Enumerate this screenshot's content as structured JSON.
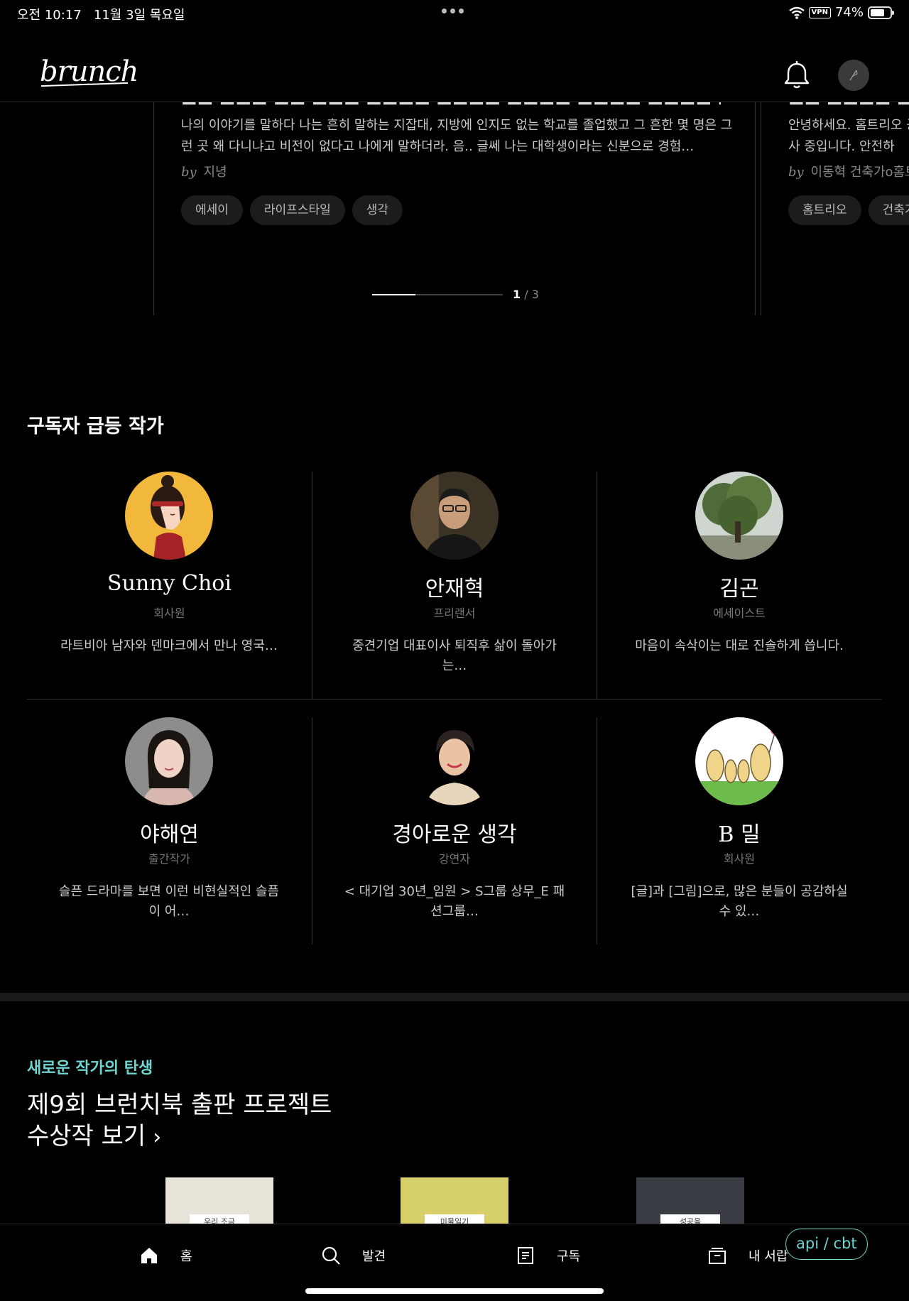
{
  "status_bar": {
    "time": "오전 10:17",
    "date": "11월 3일 목요일",
    "vpn": "VPN",
    "battery": "74%",
    "battery_level": 0.74
  },
  "header": {
    "logo": "brunch",
    "icons": [
      "bell-icon",
      "pen-icon"
    ]
  },
  "carousel": {
    "main_card": {
      "excerpt": "나의 이야기를 말하다 나는 흔히 말하는 지잡대, 지방에 인지도 없는 학교를 졸업했고 그 흔한 몇 명은 그런 곳 왜 다니냐고 비전이 없다고 나에게 말하더라. 음.. 글쎄 나는 대학생이라는 신분으로 경험…",
      "by": "by",
      "author": "지녕",
      "tags": [
        "에세이",
        "라이프스타일",
        "생각"
      ]
    },
    "next_card": {
      "excerpt": "안녕하세요. 홈트리오 공사 중입니다. 안전하",
      "by": "by",
      "author": "이동혁 건축가o홈트",
      "tags": [
        "홈트리오",
        "건축가"
      ]
    },
    "pager": {
      "current": "1",
      "separator": "/",
      "total": "3",
      "progress": 0.333
    }
  },
  "rising_authors": {
    "title": "구독자 급등 작가",
    "authors": [
      {
        "name": "Sunny Choi",
        "job": "회사원",
        "desc": "라트비아 남자와 덴마크에서 만나 영국…"
      },
      {
        "name": "안재혁",
        "job": "프리랜서",
        "desc": "중견기업 대표이사 퇴직후 삶이 돌아가는…"
      },
      {
        "name": "김곤",
        "job": "에세이스트",
        "desc": "마음이 속삭이는 대로 진솔하게 씁니다."
      },
      {
        "name": "야해연",
        "job": "출간작가",
        "desc": "슬픈 드라마를 보면 이런 비현실적인 슬픔이 어…"
      },
      {
        "name": "경아로운 생각",
        "job": "강연자",
        "desc": "< 대기업 30년_임원 > S그룹 상무_E 패션그룹…"
      },
      {
        "name": "B 밀",
        "job": "회사원",
        "desc": "[글]과 [그림]으로, 많은 분들이 공감하실 수 있…"
      }
    ]
  },
  "promo": {
    "kicker": "새로운 작가의 탄생",
    "title_line1": "제9회 브런치북 출판 프로젝트",
    "title_line2": "수상작 보기",
    "books": [
      {
        "label": "우리 조금",
        "color": "#e8e3d8"
      },
      {
        "label": "미물일기",
        "color": "#d6cf6a"
      },
      {
        "label": "성공을",
        "color": "#3a3d44"
      }
    ]
  },
  "bottom_nav": {
    "items": [
      {
        "label": "홈",
        "icon": "home-icon"
      },
      {
        "label": "발견",
        "icon": "search-icon"
      },
      {
        "label": "구독",
        "icon": "document-icon"
      },
      {
        "label": "내 서랍",
        "icon": "drawer-icon"
      }
    ],
    "api_badge": "api / cbt"
  }
}
